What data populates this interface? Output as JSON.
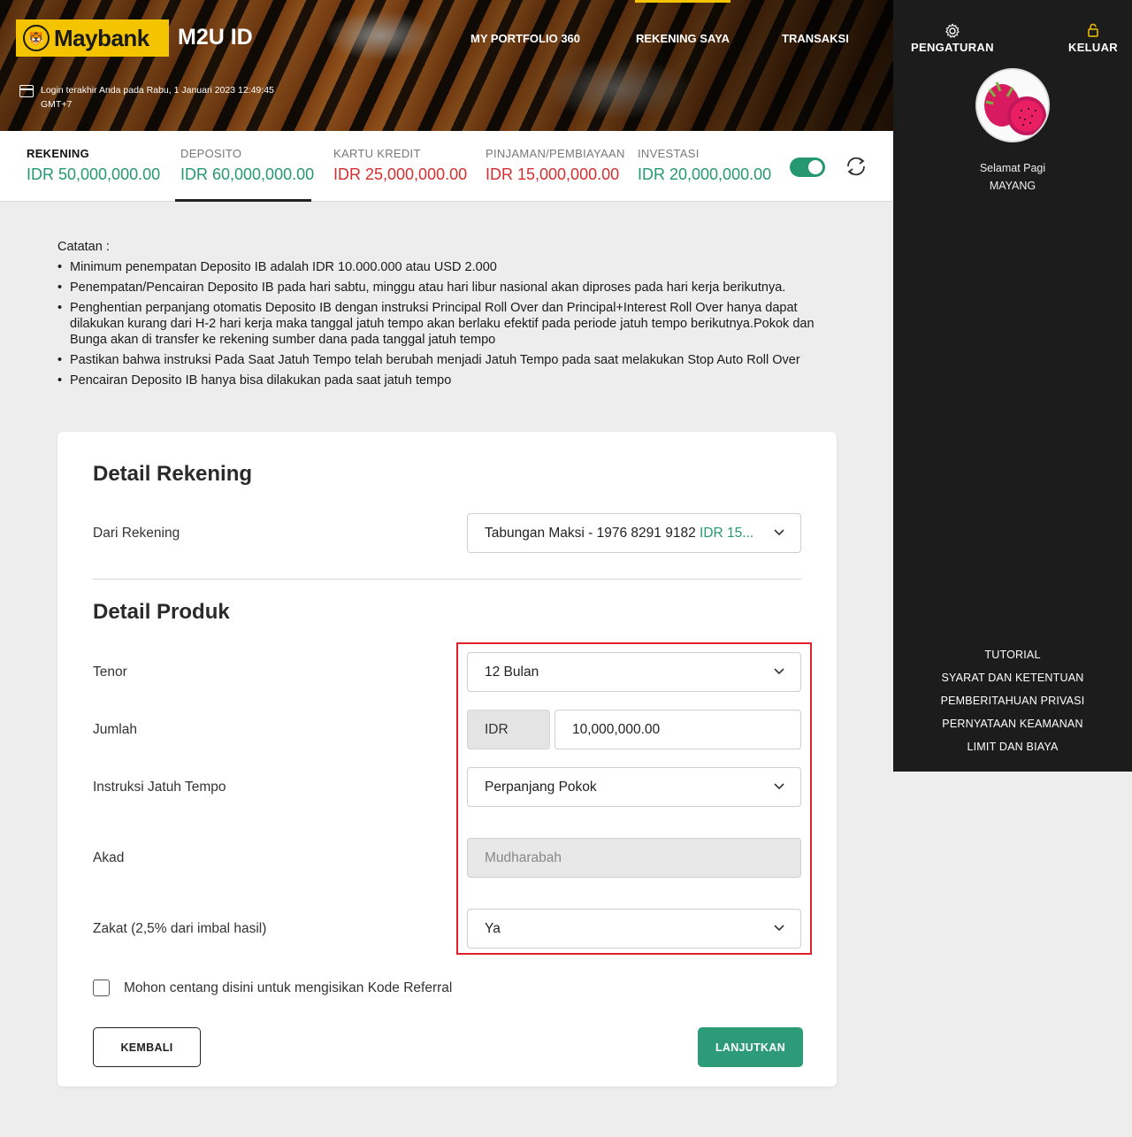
{
  "header": {
    "brand": "Maybank",
    "app_name": "M2U ID",
    "last_login": "Login terakhir Anda pada Rabu, 1 Januari 2023 12:49:45 GMT+7",
    "nav": [
      "MY PORTFOLIO 360",
      "REKENING SAYA",
      "TRANSAKSI"
    ],
    "active_nav": "REKENING SAYA"
  },
  "balances": [
    {
      "label": "REKENING",
      "value": "IDR 50,000,000.00",
      "color": "#259872"
    },
    {
      "label": "DEPOSITO",
      "value": "IDR 60,000,000.00",
      "color": "#259872"
    },
    {
      "label": "KARTU KREDIT",
      "value": "IDR 25,000,000.00",
      "color": "#d32f2f"
    },
    {
      "label": "PINJAMAN/PEMBIAYAAN",
      "value": "IDR 15,000,000.00",
      "color": "#d32f2f"
    },
    {
      "label": "INVESTASI",
      "value": "IDR 20,000,000.00",
      "color": "#259872"
    }
  ],
  "sidebar": {
    "settings": "PENGATURAN",
    "logout": "KELUAR",
    "greeting": "Selamat Pagi",
    "user": "MAYANG",
    "links": [
      "TUTORIAL",
      "SYARAT DAN KETENTUAN",
      "PEMBERITAHUAN PRIVASI",
      "PERNYATAAN KEAMANAN",
      "LIMIT DAN BIAYA"
    ]
  },
  "notes": {
    "title": "Catatan :",
    "items": [
      "Minimum penempatan Deposito IB adalah IDR 10.000.000 atau USD 2.000",
      "Penempatan/Pencairan Deposito IB pada hari sabtu, minggu atau hari libur nasional akan diproses pada hari kerja berikutnya.",
      "Penghentian perpanjang otomatis Deposito IB dengan instruksi Principal Roll Over dan Principal+Interest Roll Over hanya dapat dilakukan kurang dari H-2 hari kerja maka tanggal jatuh tempo akan berlaku efektif pada periode jatuh tempo berikutnya.Pokok dan Bunga akan di transfer ke rekening sumber dana pada tanggal jatuh tempo",
      "Pastikan bahwa instruksi Pada Saat Jatuh Tempo telah berubah menjadi Jatuh Tempo pada saat melakukan Stop Auto Roll Over",
      "Pencairan Deposito IB hanya bisa dilakukan pada saat jatuh tempo"
    ]
  },
  "form": {
    "account_section": "Detail Rekening",
    "from_account_label": "Dari Rekening",
    "from_account_value": "Tabungan Maksi - 1976 8291 9182",
    "from_account_balance": "IDR 15...",
    "product_section": "Detail Produk",
    "tenor_label": "Tenor",
    "tenor_value": "12 Bulan",
    "amount_label": "Jumlah",
    "currency": "IDR",
    "amount_value": "10,000,000.00",
    "maturity_label": "Instruksi Jatuh Tempo",
    "maturity_value": "Perpanjang Pokok",
    "akad_label": "Akad",
    "akad_value": "Mudharabah",
    "zakat_label": "Zakat (2,5% dari imbal hasil)",
    "zakat_value": "Ya",
    "referral_label": "Mohon centang disini untuk mengisikan Kode Referral",
    "back_button": "KEMBALI",
    "next_button": "LANJUTKAN"
  }
}
